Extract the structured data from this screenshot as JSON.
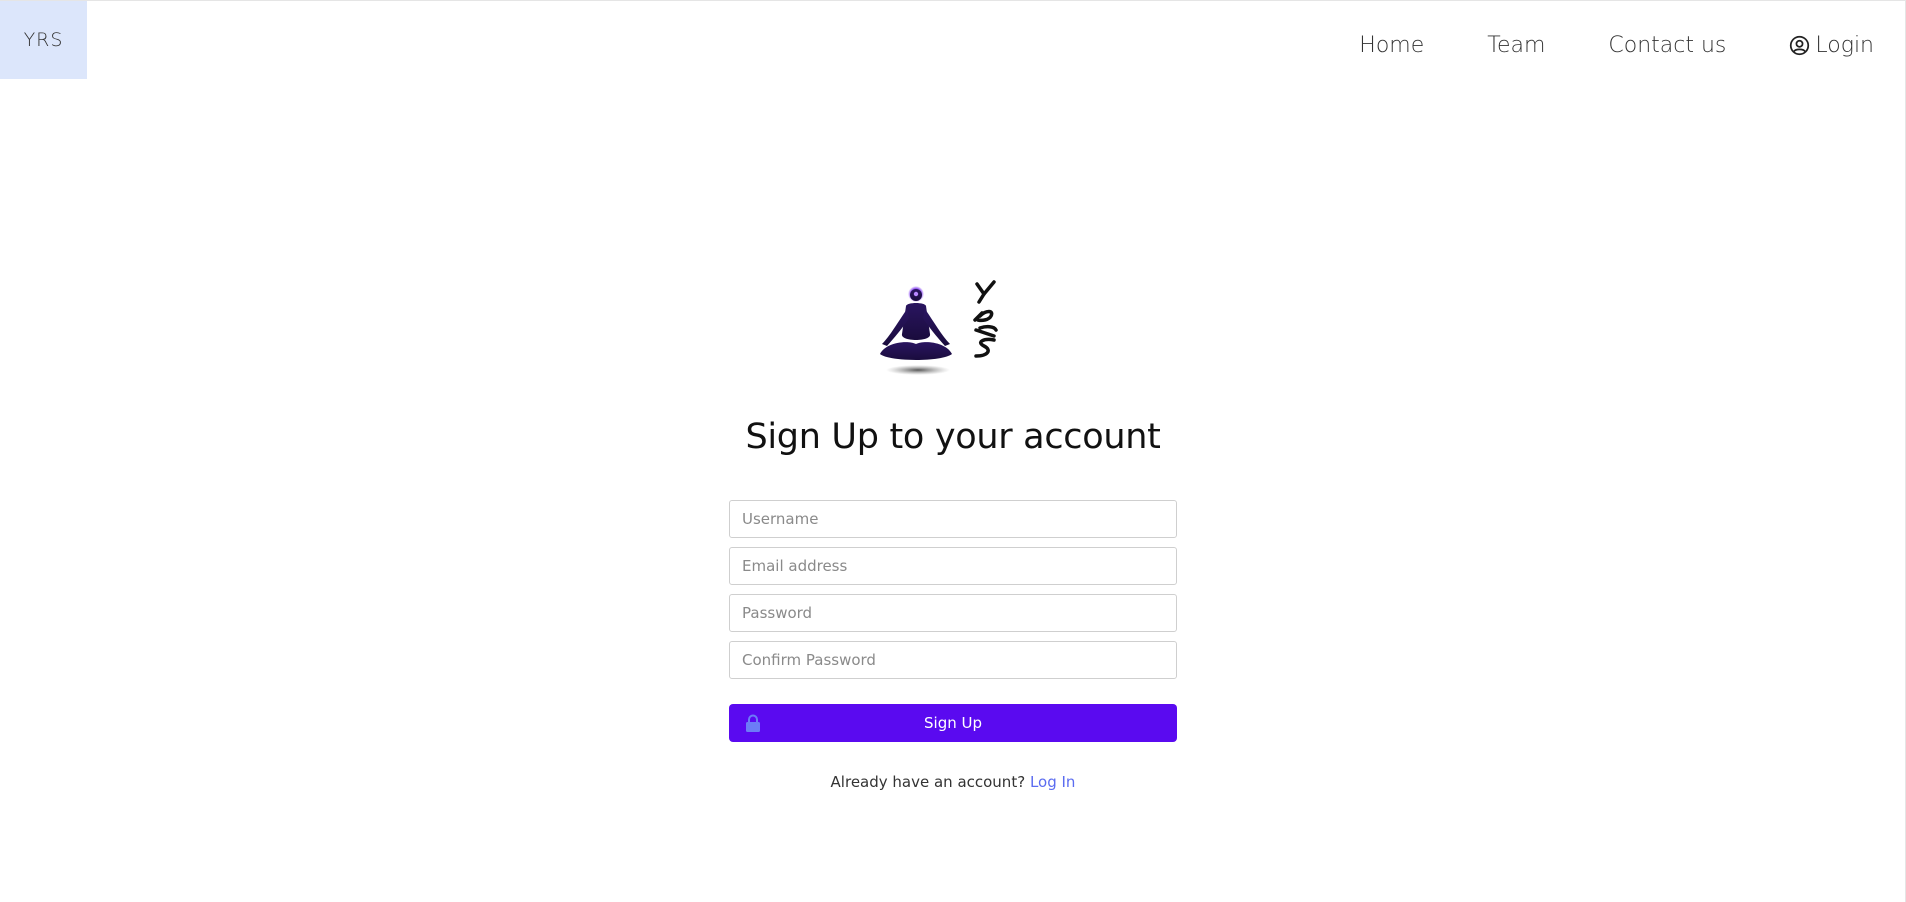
{
  "brand": {
    "label": "YRS"
  },
  "nav": {
    "items": [
      {
        "label": "Home"
      },
      {
        "label": "Team"
      },
      {
        "label": "Contact us"
      },
      {
        "label": "Login",
        "icon": "user-circle-icon"
      }
    ]
  },
  "logo": {
    "text": "YRS",
    "icon": "meditating-figure-logo"
  },
  "form": {
    "title": "Sign Up to your account",
    "username": {
      "placeholder": "Username",
      "value": ""
    },
    "email": {
      "placeholder": "Email address",
      "value": ""
    },
    "password": {
      "placeholder": "Password",
      "value": ""
    },
    "confirm_password": {
      "placeholder": "Confirm Password",
      "value": ""
    },
    "submit_label": "Sign Up",
    "submit_icon": "lock-icon",
    "already_text": "Already have an account?",
    "login_link": "Log In"
  },
  "colors": {
    "brand_bg": "#dce6fb",
    "primary": "#5a0af0",
    "link": "#5b6cf0",
    "lock_icon": "#6c7cf7"
  }
}
